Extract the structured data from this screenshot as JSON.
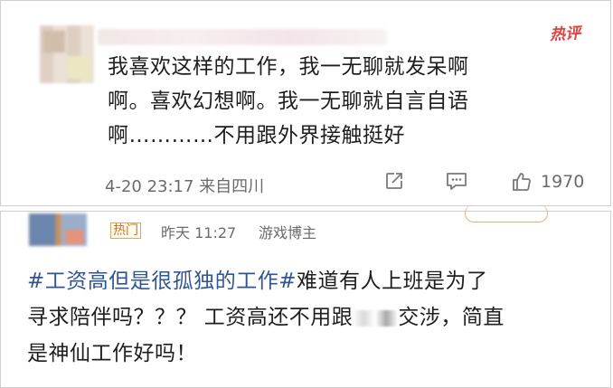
{
  "comment1": {
    "hot_badge": "热评",
    "lines": [
      "我喜欢这样的工作，我一无聊就发呆啊",
      "啊。喜欢幻想啊。我一无聊就自言自语",
      "啊…………不用跟外界接触挺好"
    ],
    "meta": "4-20 23:17  来自四川",
    "like_count": "1970"
  },
  "comment2": {
    "hot_tag": "热门",
    "time": "昨天 11:27",
    "source": "游戏博主",
    "line1_hashtag": "#工资高但是很孤独的工作#",
    "line1_rest": "难道有人上班是为了",
    "line2_before": "寻求陪伴吗？？？ 工资高还不用跟",
    "line2_after": "交涉，简直",
    "line3": "是神仙工作好吗！"
  },
  "icons": {
    "share": "share-icon",
    "comment": "comment-icon",
    "like": "thumbs-up-icon"
  },
  "colors": {
    "hot_red": "#e0413e",
    "hashtag_blue": "#2f5597",
    "meta_gray": "#6b6b6b"
  }
}
